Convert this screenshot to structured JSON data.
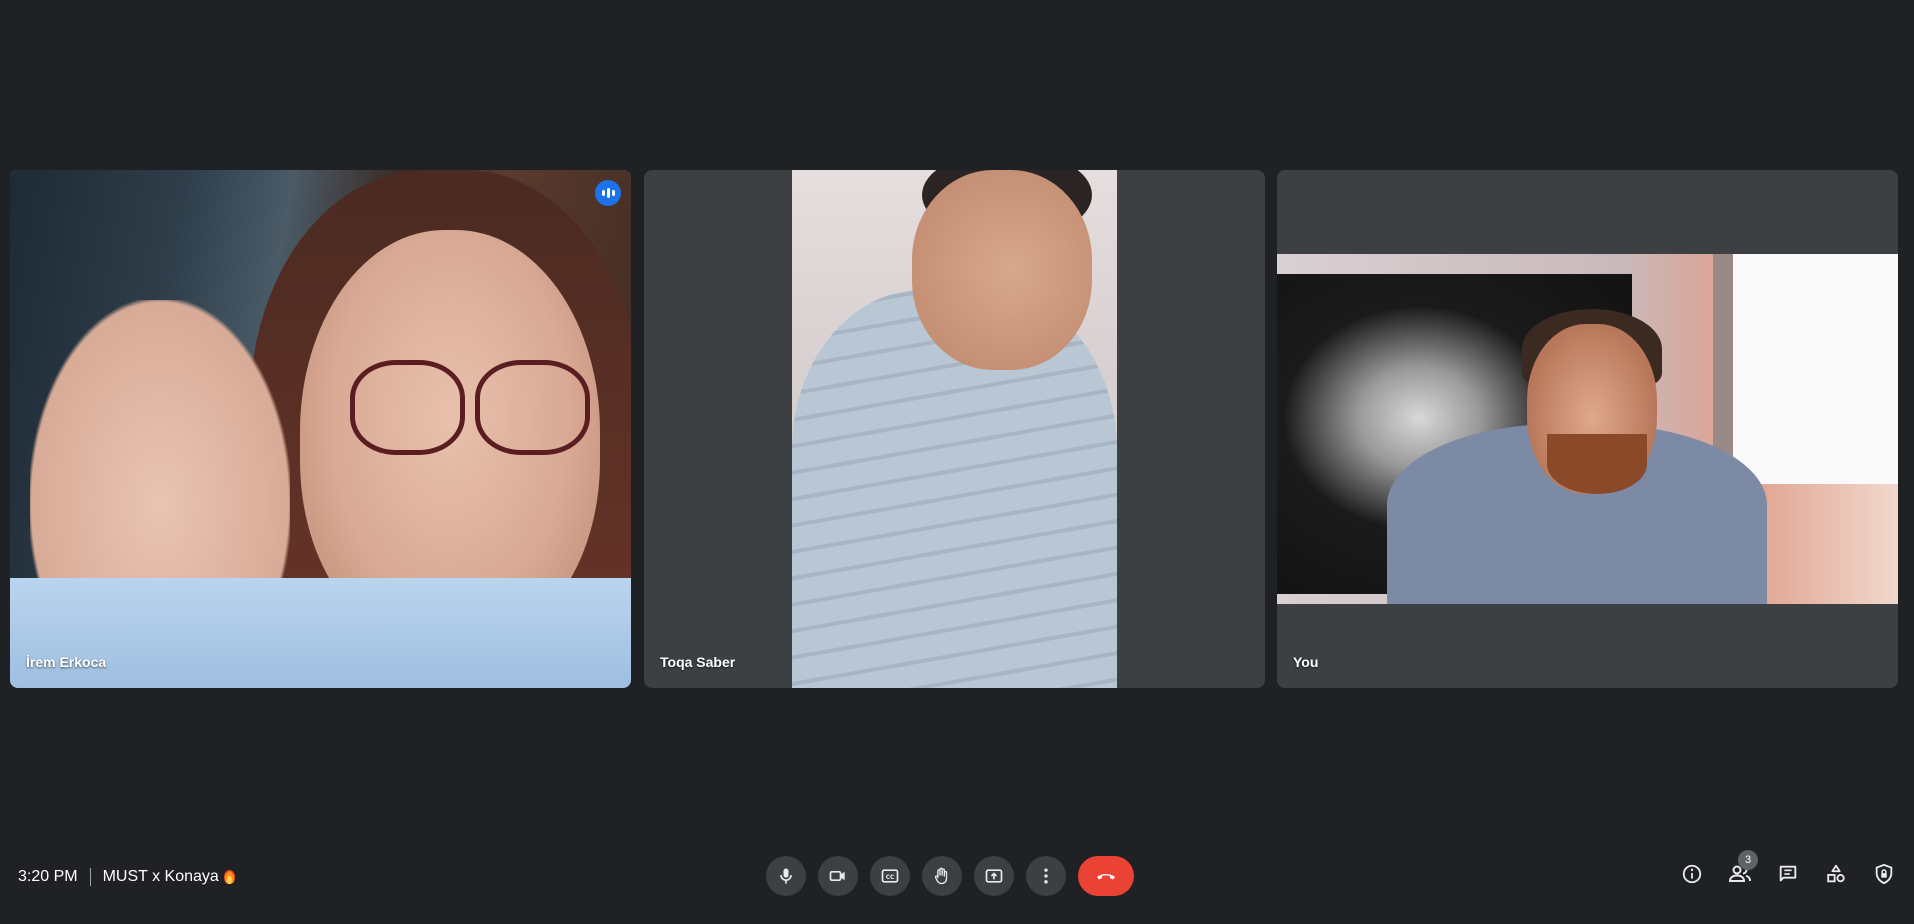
{
  "participants": [
    {
      "name": "İrem Erkoca",
      "speaking": true
    },
    {
      "name": "Toqa Saber",
      "speaking": false
    },
    {
      "name": "You",
      "speaking": false
    }
  ],
  "footer": {
    "time": "3:20 PM",
    "meeting_title": "MUST x Konaya"
  },
  "controls": [
    {
      "icon": "microphone-icon"
    },
    {
      "icon": "camera-icon"
    },
    {
      "icon": "captions-icon"
    },
    {
      "icon": "raise-hand-icon"
    },
    {
      "icon": "present-screen-icon"
    },
    {
      "icon": "more-options-icon"
    },
    {
      "icon": "end-call-icon",
      "color": "#ea4335"
    }
  ],
  "side_panel": {
    "people_count": "3",
    "icons": [
      "info-icon",
      "people-icon",
      "chat-icon",
      "activities-icon",
      "host-controls-icon"
    ]
  },
  "colors": {
    "background": "#202124",
    "tile": "#3c4043",
    "active_border": "#8ab4f8",
    "speaking_badge": "#1a73e8"
  }
}
